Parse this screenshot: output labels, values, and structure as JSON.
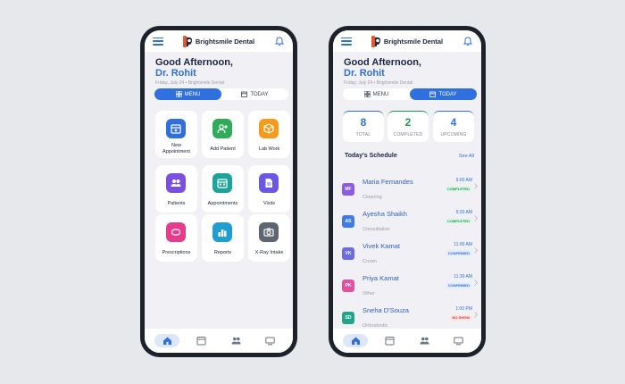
{
  "app": {
    "brand_name": "Brightsmile Dental",
    "greeting": "Good Afternoon,",
    "doctor": "Dr. Rohit",
    "subline": "Friday, July 24 • Brightsmile Dental"
  },
  "toggle": {
    "menu_label": "MENU",
    "today_label": "TODAY"
  },
  "menu_tiles": [
    {
      "label": "New Appointment",
      "icon": "calendar-plus-icon",
      "color": "#2f6fde"
    },
    {
      "label": "Add Patient",
      "icon": "add-patient-icon",
      "color": "#2fab5a"
    },
    {
      "label": "Lab Work",
      "icon": "box-icon",
      "color": "#f59a1b"
    },
    {
      "label": "Patients",
      "icon": "users-icon",
      "color": "#7b4fe0"
    },
    {
      "label": "Appointments",
      "icon": "calendar-icon",
      "color": "#1ea39a"
    },
    {
      "label": "Visits",
      "icon": "document-icon",
      "color": "#6b57e6"
    },
    {
      "label": "Prescriptions",
      "icon": "pill-icon",
      "color": "#e53d8c"
    },
    {
      "label": "Reports",
      "icon": "bar-chart-icon",
      "color": "#1f9fd0"
    },
    {
      "label": "X-Ray Intake",
      "icon": "camera-icon",
      "color": "#5d6472"
    }
  ],
  "stats": [
    {
      "value": "8",
      "label": "TOTAL",
      "color": "#2f6fde"
    },
    {
      "value": "2",
      "label": "COMPLETED",
      "color": "#1f9a57"
    },
    {
      "value": "4",
      "label": "UPCOMING",
      "color": "#2f6fde"
    }
  ],
  "schedule": {
    "title": "Today's Schedule",
    "see_all": "See All",
    "rows": [
      {
        "initials": "MF",
        "name": "Maria Fernandes",
        "type": "Cleaning",
        "time": "9:00 AM",
        "status": "COMPLETED",
        "avatar_color": "#8d5ae6"
      },
      {
        "initials": "AS",
        "name": "Ayesha Shaikh",
        "type": "Consultation",
        "time": "9:30 AM",
        "status": "COMPLETED",
        "avatar_color": "#3f7be6"
      },
      {
        "initials": "VK",
        "name": "Vivek Kamat",
        "type": "Crown",
        "time": "11:00 AM",
        "status": "CONFIRMED",
        "avatar_color": "#6a6ce6"
      },
      {
        "initials": "PK",
        "name": "Priya Kamat",
        "type": "Other",
        "time": "11:30 AM",
        "status": "CONFIRMED",
        "avatar_color": "#e64fa0"
      },
      {
        "initials": "SD",
        "name": "Sneha D'Souza",
        "type": "Orthodontic",
        "time": "1:00 PM",
        "status": "NO SHOW",
        "avatar_color": "#22a48a"
      }
    ]
  },
  "nav": [
    "home-icon",
    "calendar-icon",
    "users-icon",
    "monitor-icon"
  ]
}
